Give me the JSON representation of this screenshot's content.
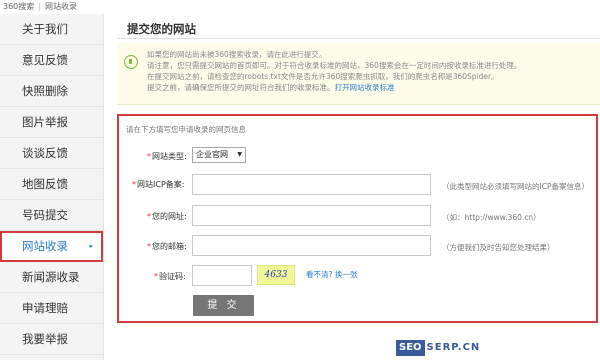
{
  "breadcrumb": {
    "root": "360搜索",
    "current": "网站收录"
  },
  "sidebar": {
    "items": [
      {
        "label": "关于我们"
      },
      {
        "label": "意见反馈"
      },
      {
        "label": "快照删除"
      },
      {
        "label": "图片举报"
      },
      {
        "label": "谈谈反馈"
      },
      {
        "label": "地图反馈"
      },
      {
        "label": "号码提交"
      },
      {
        "label": "网站收录",
        "active": true,
        "arrow": "▸"
      },
      {
        "label": "新闻源收录"
      },
      {
        "label": "申请理赔"
      },
      {
        "label": "我要举报"
      }
    ]
  },
  "page": {
    "title": "提交您的网站"
  },
  "tips": {
    "lines": [
      "如果您的网站尚未被360搜索收录，请在此进行提交。",
      "请注意，您只需提交网站的首页即可。对于符合收录标准的网站，360搜索会在一定时间内按收录标准进行处理。",
      "在提交网站之前，请检查您的robots.txt文件是否允许360搜索爬虫抓取，我们的爬虫名称是360Spider。",
      "提交之前，请确保您所提交的网址符合我们的收录标准。"
    ],
    "link": "打开网站收录标准"
  },
  "form": {
    "intro": "请在下方填写您申请收录的网页信息",
    "site_type": {
      "label": "网站类型:",
      "value": "企业官网",
      "caret": "▼"
    },
    "icp": {
      "label": "网站ICP备案:",
      "value": "",
      "hint": "（此类型网站必须填写网站的ICP备案信息）"
    },
    "url": {
      "label": "您的网址:",
      "value": "",
      "hint": "（如：http://www.360.cn）"
    },
    "email": {
      "label": "您的邮箱:",
      "value": "",
      "hint": "（方便我们及时告知您处理结果）"
    },
    "captcha": {
      "label": "验证码:",
      "value": "",
      "image_text": "4633",
      "refresh": "看不清? 换一张"
    },
    "submit": "提 交"
  },
  "watermark": {
    "seo": "SEO",
    "rest": "SERP.CN"
  }
}
